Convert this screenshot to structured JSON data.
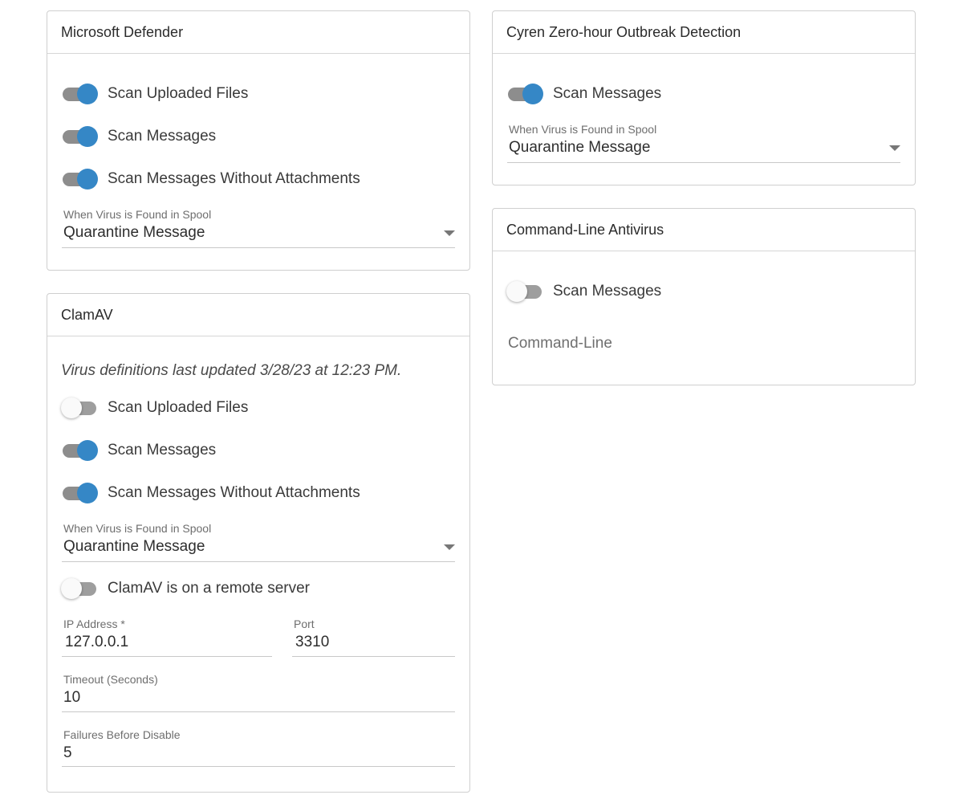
{
  "defender": {
    "title": "Microsoft Defender",
    "toggles": [
      {
        "label": "Scan Uploaded Files",
        "on": true
      },
      {
        "label": "Scan Messages",
        "on": true
      },
      {
        "label": "Scan Messages Without Attachments",
        "on": true
      }
    ],
    "spool_label": "When Virus is Found in Spool",
    "spool_value": "Quarantine Message"
  },
  "clamav": {
    "title": "ClamAV",
    "note": "Virus definitions last updated 3/28/23 at 12:23 PM.",
    "toggles": [
      {
        "label": "Scan Uploaded Files",
        "on": false
      },
      {
        "label": "Scan Messages",
        "on": true
      },
      {
        "label": "Scan Messages Without Attachments",
        "on": true
      }
    ],
    "spool_label": "When Virus is Found in Spool",
    "spool_value": "Quarantine Message",
    "remote_toggle": {
      "label": "ClamAV is on a remote server",
      "on": false
    },
    "ip_label": "IP Address *",
    "ip_value": "127.0.0.1",
    "port_label": "Port",
    "port_value": "3310",
    "timeout_label": "Timeout (Seconds)",
    "timeout_value": "10",
    "failures_label": "Failures Before Disable",
    "failures_value": "5"
  },
  "cyren": {
    "title": "Cyren Zero-hour Outbreak Detection",
    "toggle": {
      "label": "Scan Messages",
      "on": true
    },
    "spool_label": "When Virus is Found in Spool",
    "spool_value": "Quarantine Message"
  },
  "cmdline": {
    "title": "Command-Line Antivirus",
    "toggle": {
      "label": "Scan Messages",
      "on": false
    },
    "command_placeholder": "Command-Line"
  },
  "colors": {
    "toggle_on": "#3587c6",
    "toggle_off": "#fafafa",
    "border": "#cfcfcf"
  }
}
